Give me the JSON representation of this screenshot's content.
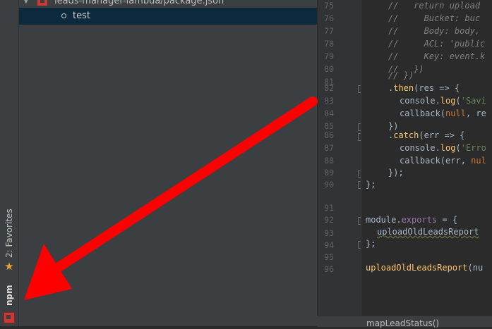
{
  "sidebar": {
    "favorites_label": "2: Favorites",
    "npm_label": "npm"
  },
  "project_tree": {
    "header": "leads-manager-lambda/package.json",
    "scripts": [
      {
        "label": "test"
      }
    ]
  },
  "editor": {
    "line_numbers": [
      "75",
      "76",
      "77",
      "78",
      "79",
      "80",
      "81",
      "82",
      "83",
      "84",
      "85",
      "86",
      "87",
      "88",
      "89",
      "90",
      "91",
      "92",
      "93",
      "94",
      "95",
      "96",
      "97"
    ],
    "lines": [
      {
        "n": "75",
        "t": "    //   return upload"
      },
      {
        "n": "76",
        "t": "    //     Bucket: buc"
      },
      {
        "n": "77",
        "t": "    //     Body: body,"
      },
      {
        "n": "78",
        "t": "    //     ACL: 'public"
      },
      {
        "n": "79",
        "t": "    //     Key: event.k"
      },
      {
        "n": "80",
        "t": "    //   })"
      },
      {
        "n": "81",
        "t": "    // })"
      },
      {
        "n": "82",
        "t": "    .then(res => {"
      },
      {
        "n": "83",
        "t": "      console.log('Savi"
      },
      {
        "n": "84",
        "t": "      callback(null, re"
      },
      {
        "n": "85",
        "t": "    })"
      },
      {
        "n": "86",
        "t": "    .catch(err => {"
      },
      {
        "n": "87",
        "t": "      console.log('Erro"
      },
      {
        "n": "88",
        "t": "      callback(err, nul"
      },
      {
        "n": "89",
        "t": "    });"
      },
      {
        "n": "90",
        "t": "};"
      },
      {
        "n": "91",
        "t": ""
      },
      {
        "n": "92",
        "t": ""
      },
      {
        "n": "93",
        "t": "module.exports = {"
      },
      {
        "n": "94",
        "t": "  uploadOldLeadsReport"
      },
      {
        "n": "95",
        "t": "};"
      },
      {
        "n": "96",
        "t": ""
      },
      {
        "n": "97",
        "t": "uploadOldLeadsReport(nu"
      }
    ],
    "segments": {
      "l75": "//   return upload",
      "l76": "//     Bucket: buc",
      "l77": "//     Body: body,",
      "l78": "//     ACL: 'public",
      "l79": "//     Key: event.k",
      "l80": "//   })",
      "l81": "// })",
      "dot": ".",
      "then": "then",
      "then_rest": "(res => {",
      "console": "console.",
      "log": "log",
      "open_paren": "(",
      "str_saving": "'Savi",
      "callback": "callback",
      "null_kw": "null",
      "cb83_rest": ", re",
      "close_brace_paren": "})",
      "catch": "catch",
      "catch_rest": "(err => {",
      "str_error": "'Erro",
      "cb88_mid": "(err, ",
      "nul_kw": "nul",
      "close_semi": "});",
      "end_fn": "};",
      "module": "module.",
      "exports": "exports",
      "exports_rest": " = {",
      "export_item": "uploadOldLeadsReport",
      "call_name": "uploadOldLeadsReport",
      "call_rest": "(nu",
      "paren_open": "("
    }
  },
  "status_bar": {
    "text": "mapLeadStatus()"
  },
  "annotation": {
    "arrow_color": "#ff0000"
  },
  "colors": {
    "editor_bg": "#2b2b2b",
    "panel_bg": "#3c3f41",
    "selection": "#0d293e",
    "keyword": "#cc7832",
    "function": "#ffc66d",
    "string": "#6a8759",
    "comment": "#808080",
    "property": "#9876aa"
  }
}
